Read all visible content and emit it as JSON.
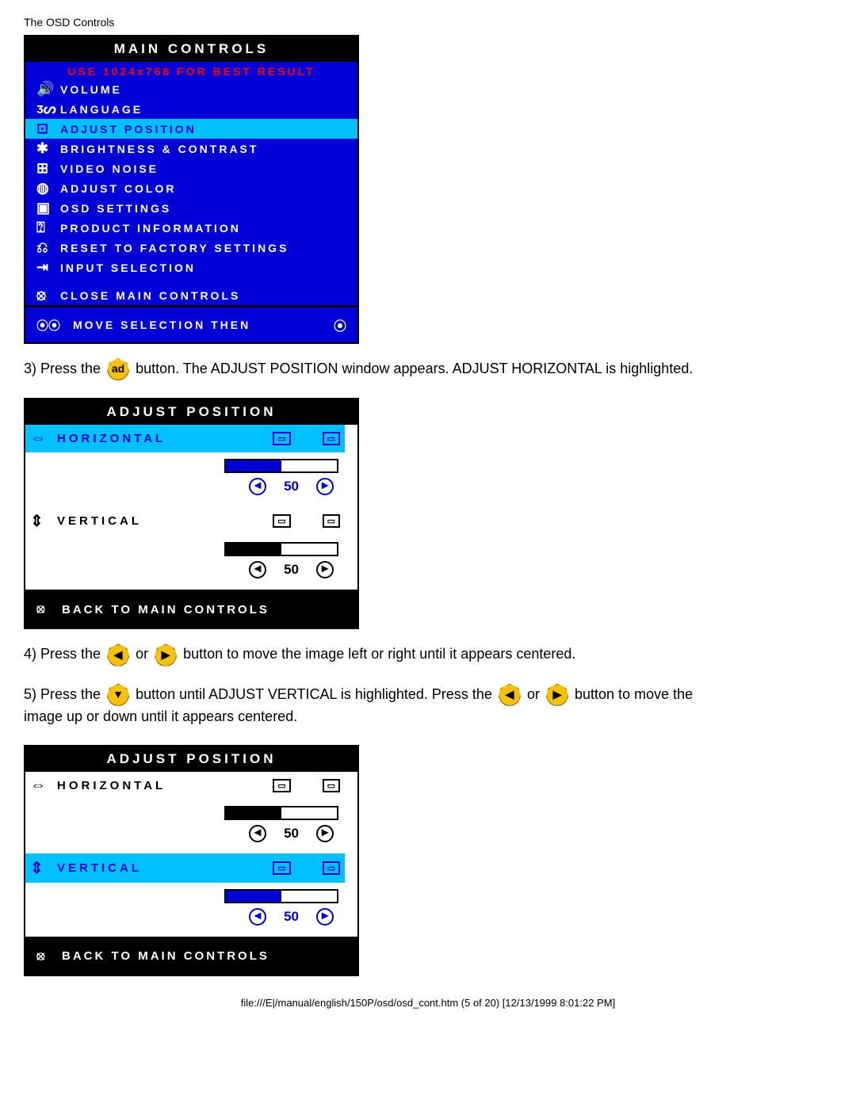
{
  "header": "The OSD Controls",
  "main_controls": {
    "title": "MAIN CONTROLS",
    "subtitle": "USE 1024x768 FOR BEST RESULT",
    "items": [
      {
        "icon": "🔊",
        "label": "VOLUME"
      },
      {
        "icon": "ᴣᔕ",
        "label": "LANGUAGE"
      },
      {
        "icon": "⊡",
        "label": "ADJUST POSITION",
        "selected": true
      },
      {
        "icon": "✱",
        "label": "BRIGHTNESS & CONTRAST"
      },
      {
        "icon": "⊞",
        "label": "VIDEO NOISE"
      },
      {
        "icon": "◍",
        "label": "ADJUST COLOR"
      },
      {
        "icon": "▣",
        "label": "OSD SETTINGS"
      },
      {
        "icon": "⍰",
        "label": "PRODUCT INFORMATION"
      },
      {
        "icon": "⎌",
        "label": "RESET TO FACTORY SETTINGS"
      },
      {
        "icon": "⇥",
        "label": "INPUT SELECTION"
      }
    ],
    "close_label": "CLOSE MAIN CONTROLS",
    "close_icon": "⦻",
    "footer_icons": "⦿⦿",
    "footer_text": "MOVE SELECTION THEN",
    "footer_right_icon": "⦿"
  },
  "step3": {
    "prefix": "3) Press the ",
    "suffix": " button. The ADJUST POSITION window appears. ADJUST HORIZONTAL is highlighted.",
    "icon": "ad"
  },
  "adjust1": {
    "title": "ADJUST POSITION",
    "horizontal": {
      "label": "HORIZONTAL",
      "value": "50",
      "fill_pct": 50,
      "selected": true
    },
    "vertical": {
      "label": "VERTICAL",
      "value": "50",
      "fill_pct": 50,
      "selected": false
    },
    "back": "BACK TO MAIN CONTROLS",
    "back_icon": "⦻"
  },
  "step4": {
    "prefix": "4) Press the",
    "or": " or ",
    "suffix": " button to move the image left or right until it appears centered.",
    "icon_left": "◀",
    "icon_right": "▶"
  },
  "step5": {
    "p1_prefix": "5) Press the ",
    "p1_mid": " button until ADJUST VERTICAL is highlighted. Press the ",
    "or": " or ",
    "p1_suffix": " button to move the",
    "p2": "image up or down until it appears centered.",
    "icon_down": "▼",
    "icon_left": "◀",
    "icon_right": "▶"
  },
  "adjust2": {
    "title": "ADJUST POSITION",
    "horizontal": {
      "label": "HORIZONTAL",
      "value": "50",
      "fill_pct": 50,
      "selected": false
    },
    "vertical": {
      "label": "VERTICAL",
      "value": "50",
      "fill_pct": 50,
      "selected": true
    },
    "back": "BACK TO MAIN CONTROLS",
    "back_icon": "⦻"
  },
  "footer": "file:///E|/manual/english/150P/osd/osd_cont.htm (5 of 20) [12/13/1999 8:01:22 PM]"
}
